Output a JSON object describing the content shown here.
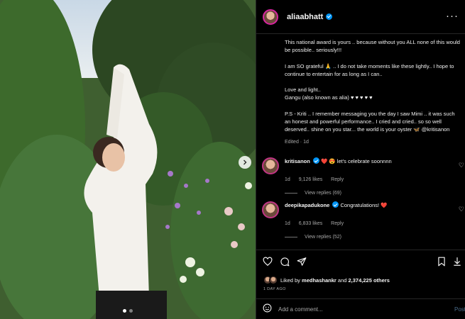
{
  "post": {
    "username": "aliaabhatt",
    "more_icon": "more-horizontal-icon",
    "caption": [
      "This national award is yours .. because without you ALL none of this would be possible.. seriously!!!",
      "I am SO grateful 🙏 .. I do not take moments like these lightly.. I hope to continue to entertain for as long as I can..",
      "Love and light..\nGangu (also known as alia) ♥ ♥ ♥ ♥ ♥",
      "P.S - Kriti .. I remember messaging you the day I saw Mimi .. it was such an honest and powerful performance.. I cried and cried.. so so well deserved.. shine on you star... the world is your oyster 🦋 @kritisanon"
    ],
    "edited": "Edited · 1d"
  },
  "comments": [
    {
      "username": "kritisanon",
      "text": "❤️ 😍 let's celebrate soonnnn",
      "time": "1d",
      "likes": "9,126 likes",
      "reply": "Reply",
      "view_replies": "View replies (69)"
    },
    {
      "username": "deepikapadukone",
      "text": "Congratulations! ❤️",
      "time": "1d",
      "likes": "6,833 likes",
      "reply": "Reply",
      "view_replies": "View replies (52)"
    }
  ],
  "actions": {
    "liked_by_prefix": "Liked by ",
    "liked_by_user": "medhashankr",
    "and": " and ",
    "likes_count": "2,374,225 others",
    "timestamp": "1 DAY AGO",
    "add_comment_placeholder": "Add a comment...",
    "post_label": "Post"
  },
  "carousel": {
    "current": 1,
    "total": 2
  },
  "colors": {
    "background": "#000000",
    "verified": "#0095f6",
    "muted": "#a8a8a8",
    "heart": "#ed4956"
  }
}
